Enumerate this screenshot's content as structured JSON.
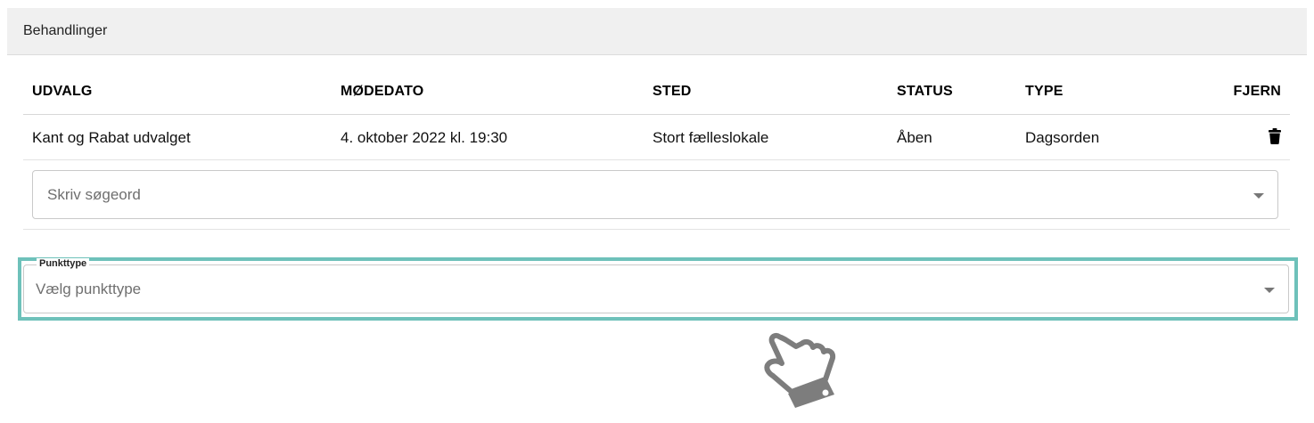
{
  "panel": {
    "title": "Behandlinger"
  },
  "table": {
    "headers": {
      "udvalg": "UDVALG",
      "modedato": "MØDEDATO",
      "sted": "STED",
      "status": "STATUS",
      "type": "TYPE",
      "fjern": "FJERN"
    },
    "rows": [
      {
        "udvalg": "Kant og Rabat udvalget",
        "modedato": "4. oktober 2022 kl. 19:30",
        "sted": "Stort fælleslokale",
        "status": "Åben",
        "type": "Dagsorden",
        "remove_icon": "trash-icon"
      }
    ]
  },
  "search": {
    "placeholder": "Skriv søgeord",
    "icon": "chevron-down-icon"
  },
  "punkttype": {
    "label": "Punkttype",
    "placeholder": "Vælg punkttype",
    "icon": "chevron-down-icon",
    "highlight_color": "#6ec1ba"
  },
  "pointer": {
    "icon": "hand-pointer-icon"
  }
}
